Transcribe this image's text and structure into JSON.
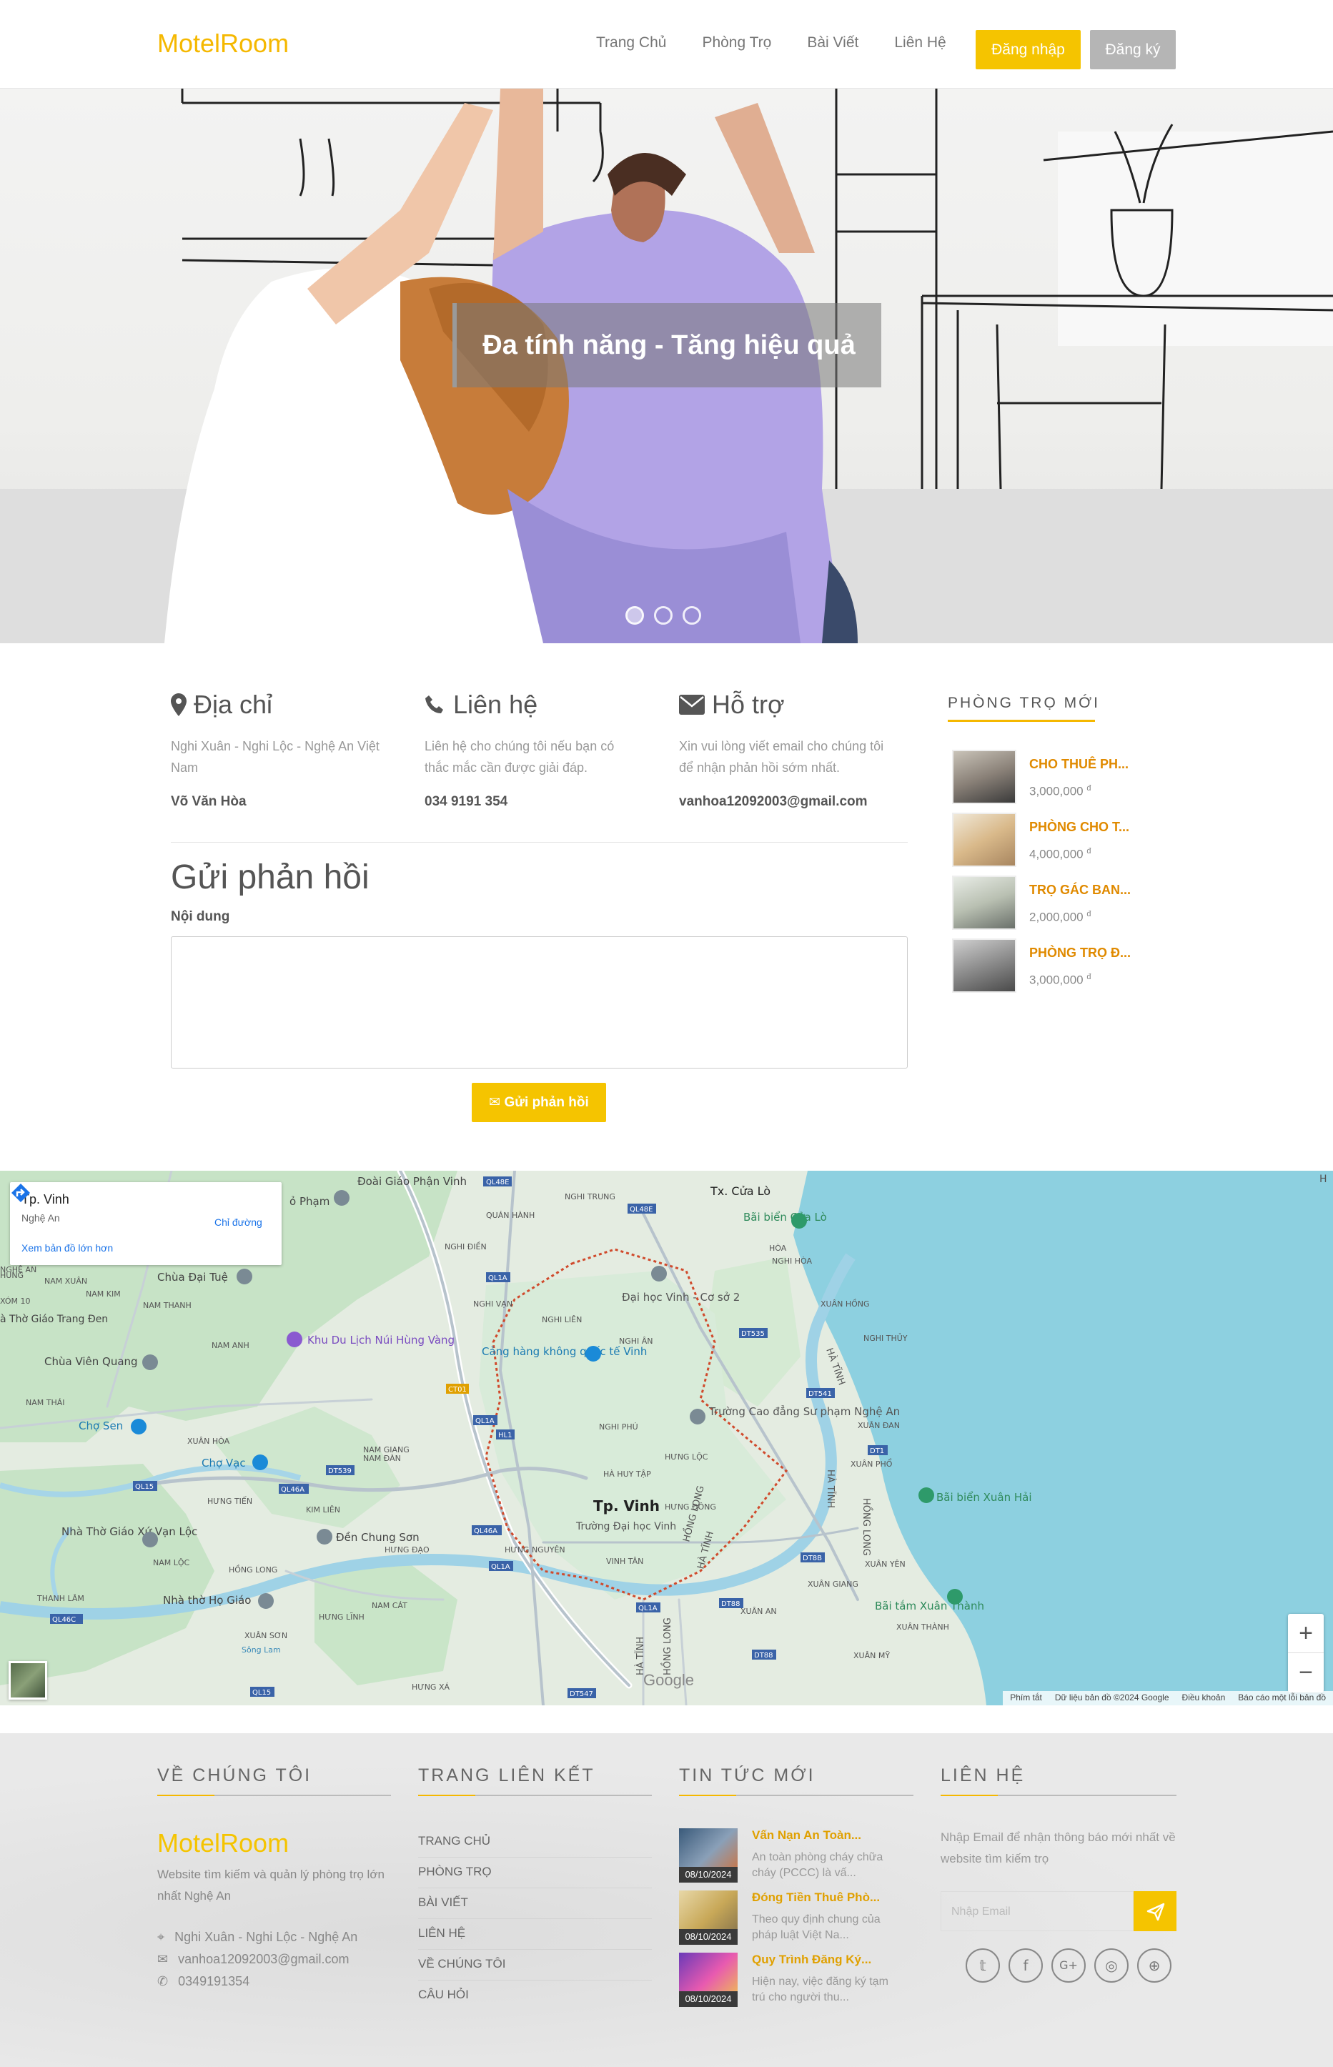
{
  "nav": {
    "logo": "MotelRoom",
    "links": [
      "Trang Chủ",
      "Phòng Trọ",
      "Bài Viết",
      "Liên Hệ"
    ],
    "login": "Đăng nhập",
    "register": "Đăng ký"
  },
  "hero": {
    "caption": "Đa tính năng - Tăng hiệu quả",
    "slides": 3,
    "active_slide": 1
  },
  "info": {
    "address": {
      "title": "Địa chỉ",
      "desc": "Nghi Xuân - Nghi Lộc - Nghệ An Việt Nam",
      "value": "Võ Văn Hòa",
      "icon": "map-marker-icon"
    },
    "contact": {
      "title": "Liên hệ",
      "desc": "Liên hệ cho chúng tôi nếu bạn có thắc mắc cần được giải đáp.",
      "value": "034 9191 354",
      "icon": "phone-icon"
    },
    "support": {
      "title": "Hỗ trợ",
      "desc": "Xin vui lòng viết email cho chúng tôi để nhận phản hồi sớm nhất.",
      "value": "vanhoa12092003@gmail.com",
      "icon": "envelope-icon"
    }
  },
  "feedback": {
    "title": "Gửi phản hồi",
    "label": "Nội dung",
    "button": "Gửi phản hồi"
  },
  "sidebar": {
    "title": "PHÒNG TRỌ MỚI",
    "rooms": [
      {
        "name": "CHO THUÊ PH...",
        "price": "3,000,000"
      },
      {
        "name": "PHÒNG CHO T...",
        "price": "4,000,000"
      },
      {
        "name": "TRỌ GÁC BAN...",
        "price": "2,000,000"
      },
      {
        "name": "PHÒNG TRỌ Đ...",
        "price": "3,000,000"
      }
    ],
    "currency": "đ"
  },
  "map": {
    "place": "Tp. Vinh",
    "region": "Nghệ An",
    "directions": "Chỉ đường",
    "larger_map": "Xem bản đồ lớn hơn",
    "city_label": "Tp. Vinh",
    "labels": [
      "Tx. Cửa Lò",
      "Bãi biển Cửa Lò",
      "Đại học Vinh - Cơ sở 2",
      "Cảng hàng không quốc tế Vinh",
      "Trường Cao đẳng Sư phạm Nghệ An",
      "Trường Đại học Vinh",
      "Bãi biển Xuân Hải",
      "Bãi tắm Xuân Thành",
      "Chùa Đại Tuệ",
      "Khu Du Lịch Núi Hùng Vàng",
      "Chùa Viên Quang",
      "Chợ Sen",
      "Chợ Vạc",
      "Đền Chung Sơn",
      "Nhà Thờ Giáo Xứ Vạn Lộc",
      "Nhà thờ Họ Giáo",
      "Đoài Giáo Phận Vinh",
      "ỏ Phạm",
      "à Thờ Giáo Trang Đen",
      "NGHI TRUNG",
      "QUÁN HÀNH",
      "NGHI ĐIỀN",
      "NGHI VẠN",
      "NGHI LIÊN",
      "NGHI ÂN",
      "NGHI PHÚ",
      "HƯNG LỘC",
      "HÀ HUY TẬP",
      "HƯNG ĐÔNG",
      "VINH TÂN",
      "HƯNG NGUYÊN",
      "NGHI HÒA",
      "XUÂN HỒNG",
      "NGHI THỦY",
      "HÒA",
      "NAM THANH",
      "NAM ANH",
      "NAM THÁI",
      "XUÂN ĐAN",
      "XUÂN PHỔ",
      "XUÂN YÊN",
      "XUÂN GIANG",
      "XUÂN AN",
      "XUÂN MỸ",
      "XUÂN THÀNH",
      "HƯNG LĨNH",
      "HƯNG XÁ",
      "THANH LÂM",
      "XUÂN HÒA",
      "NAM GIANG",
      "NAM ĐÀN",
      "NAM CÁT",
      "HƯNG TIẾN",
      "KIM LIÊN",
      "HƯNG ĐẠO",
      "NAM LỘC",
      "HỒNG LONG",
      "HÀ TĨNH",
      "NGHỆ AN",
      "Sông Lam",
      "HUNG",
      "NAM KIM",
      "XÓM 10",
      "NAM XUÂN",
      "XUÂN SƠN",
      "H"
    ],
    "roads": [
      "QL48E",
      "QL1A",
      "QL48E",
      "DT535",
      "CT01",
      "DT541",
      "QL1A",
      "HL1",
      "DT539",
      "QL46A",
      "DT1",
      "QL15",
      "QL46A",
      "QL46C",
      "QL1A",
      "QL1A",
      "DT88",
      "DT8B",
      "QL15",
      "DT547"
    ],
    "footer": [
      "Phím tắt",
      "Dữ liệu bản đồ ©2024 Google",
      "Điều khoản",
      "Báo cáo một lỗi bản đồ"
    ],
    "google": "Google",
    "zoom_in": "+",
    "zoom_out": "−"
  },
  "footer": {
    "about": {
      "title": "VỀ CHÚNG TÔI",
      "logo": "MotelRoom",
      "desc": "Website tìm kiếm và quản lý phòng trọ lớn nhất Nghệ An",
      "address": "Nghi Xuân - Nghi Lộc - Nghệ An",
      "email": "vanhoa12092003@gmail.com",
      "phone": "0349191354"
    },
    "links": {
      "title": "TRANG LIÊN KẾT",
      "items": [
        "TRANG CHỦ",
        "PHÒNG TRỌ",
        "BÀI VIẾT",
        "LIÊN HỆ",
        "VỀ CHÚNG TÔI",
        "CÂU HỎI"
      ]
    },
    "news": {
      "title": "TIN TỨC MỚI",
      "items": [
        {
          "title": "Vấn Nạn An Toàn...",
          "desc": "An toàn phòng cháy chữa cháy (PCCC) là vấ...",
          "date": "08/10/2024"
        },
        {
          "title": "Đóng Tiền Thuê Phò...",
          "desc": "Theo quy định chung của pháp luật Việt Na...",
          "date": "08/10/2024"
        },
        {
          "title": "Quy Trình Đăng Ký...",
          "desc": "Hiện nay, việc đăng ký tạm trú cho người thu...",
          "date": "08/10/2024"
        }
      ]
    },
    "contact": {
      "title": "LIÊN HỆ",
      "text": "Nhập Email để nhận thông báo mới nhất về website tìm kiếm trọ",
      "placeholder": "Nhập Email",
      "socials": [
        "twitter-icon",
        "facebook-icon",
        "google-plus-icon",
        "instagram-icon",
        "dribbble-icon"
      ]
    }
  }
}
